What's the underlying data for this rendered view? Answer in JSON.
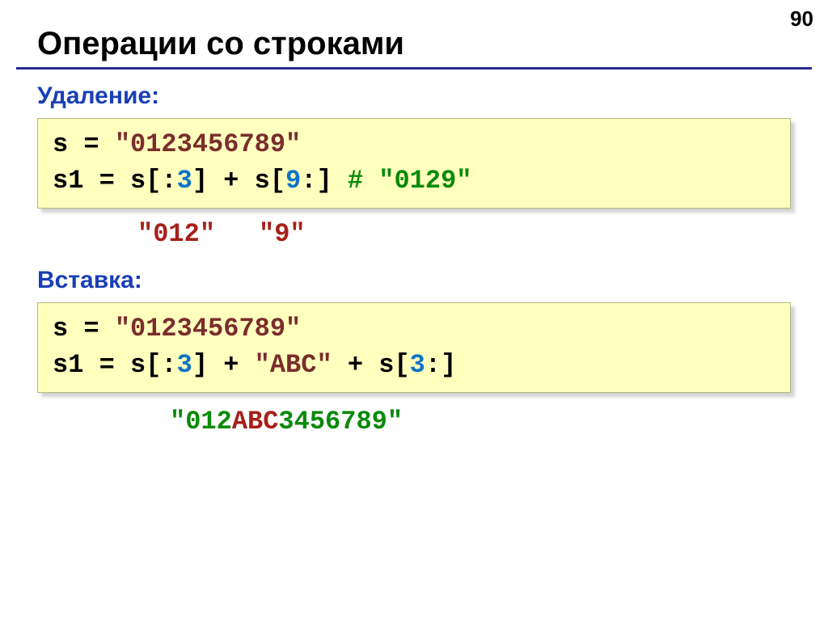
{
  "page_number": "90",
  "title": "Операции со строками",
  "section1": {
    "label": "Удаление:",
    "code": {
      "l1_s": "s",
      "l1_eq": " = ",
      "l1_str": "\"0123456789\"",
      "l2_s1": "s1",
      "l2_eq": " = ",
      "l2_pfx": "s[:",
      "l2_idx1": "3",
      "l2_mid": "] + s[",
      "l2_idx2": "9",
      "l2_sfx": ":]",
      "l2_sp": "   ",
      "l2_comment": "# \"0129\""
    },
    "annot_a": "\"012\"",
    "annot_b": "\"9\""
  },
  "section2": {
    "label": "Вставка:",
    "code": {
      "l1_s": "s",
      "l1_eq": " = ",
      "l1_str": "\"0123456789\"",
      "l2_s1": "s1",
      "l2_eq": " = ",
      "l2_a": "s[:",
      "l2_i1": "3",
      "l2_b": "] + ",
      "l2_abc": "\"ABC\"",
      "l2_c": " + s[",
      "l2_i2": "3",
      "l2_d": ":]"
    },
    "annot": {
      "q1": "\"",
      "p1": "012",
      "p2": "ABC",
      "p3": "3456789",
      "q2": "\""
    }
  }
}
